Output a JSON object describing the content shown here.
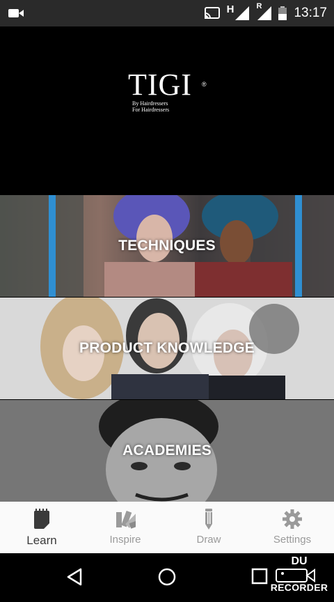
{
  "status_bar": {
    "time": "13:17",
    "network_label": "H",
    "roaming_label": "R",
    "icons": [
      "video-record-icon",
      "cast-icon",
      "signal-icon",
      "signal-roaming-icon",
      "battery-icon"
    ]
  },
  "header": {
    "brand": "TIGI",
    "registered_mark": "®",
    "tagline_line1": "By Hairdressers",
    "tagline_line2": "For Hairdressers"
  },
  "categories": [
    {
      "label": "TECHNIQUES"
    },
    {
      "label": "PRODUCT KNOWLEDGE"
    },
    {
      "label": "ACADEMIES"
    }
  ],
  "tabs": [
    {
      "label": "Learn",
      "icon": "notebook-icon",
      "active": true
    },
    {
      "label": "Inspire",
      "icon": "swatch-icon",
      "active": false
    },
    {
      "label": "Draw",
      "icon": "pencil-icon",
      "active": false
    },
    {
      "label": "Settings",
      "icon": "gear-icon",
      "active": false
    }
  ],
  "nav_bar": {
    "icons": [
      "back-icon",
      "home-icon",
      "recents-icon"
    ]
  },
  "recorder_overlay": {
    "top_text": "DU",
    "bottom_text": "RECORDER"
  },
  "colors": {
    "status_bar_bg": "#2a2a2a",
    "header_bg": "#000000",
    "tabbar_bg": "#fafafa",
    "tab_active": "#3a3a3a",
    "tab_inactive": "#9a9a9a"
  }
}
